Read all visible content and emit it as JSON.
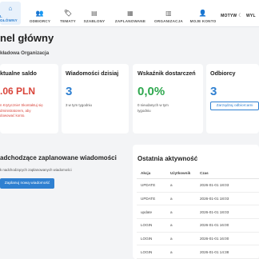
{
  "nav": {
    "items": [
      {
        "label": "L GŁÓWNY",
        "icon": "home-icon",
        "glyph": "⌂"
      },
      {
        "label": "ODBIORCY",
        "icon": "users-icon",
        "glyph": "👥"
      },
      {
        "label": "TEMATY",
        "icon": "tag-icon",
        "glyph": "🏷"
      },
      {
        "label": "SZABLONY",
        "icon": "template-icon",
        "glyph": "▤"
      },
      {
        "label": "ZAPLANOWANE",
        "icon": "calendar-icon",
        "glyph": "▦"
      },
      {
        "label": "ORGANIZACJA",
        "icon": "building-icon",
        "glyph": "▥"
      },
      {
        "label": "MOJE KONTO",
        "icon": "user-icon",
        "glyph": "👤"
      }
    ],
    "theme_label": "MOTYW",
    "theme_glyph": "☾",
    "logout_label": "WYL"
  },
  "page": {
    "title": "nel główny",
    "org": "kładowa Organizacja"
  },
  "cards": {
    "balance": {
      "title": "ktualne saldo",
      "value": ".06 PLN",
      "value_color": "#d9453b",
      "note": "n Krytycznie! Skontaktuj się\ndministratorem, aby\ndowować konto."
    },
    "today": {
      "title": "Wiadomości dzisiaj",
      "value": "3",
      "value_color": "#2f80d1",
      "note": "3 w tym tygodniu"
    },
    "delivery": {
      "title": "Wskaźnik dostarczeń",
      "value": "0,0%",
      "value_color": "#2fa84f",
      "note": "0 nieudanych w tym\ntygodniu"
    },
    "recipients": {
      "title": "Odbiorcy",
      "value": "3",
      "value_color": "#2f80d1",
      "button": "Zarządzaj odbiorcami"
    }
  },
  "scheduled": {
    "title": "adchodzące zaplanowane wiadomości",
    "note": "k nadchodzących zaplanowanych wiadomości",
    "button": "Zaplanuj nową wiadomość"
  },
  "activity": {
    "title": "Ostatnia aktywność",
    "columns": [
      "Akcja",
      "Użytkownik",
      "Czas"
    ],
    "rows": [
      [
        "UPDATE",
        "a",
        "2026-01-01 18:03"
      ],
      [
        "UPDATE",
        "a",
        "2026-01-01 18:03"
      ],
      [
        "update",
        "a",
        "2026-01-01 18:03"
      ],
      [
        "LOGIN",
        "a",
        "2026-01-01 16:00"
      ],
      [
        "LOGIN",
        "a",
        "2026-01-01 16:00"
      ],
      [
        "LOGIN",
        "a",
        "2026-01-01 14:38"
      ]
    ]
  }
}
